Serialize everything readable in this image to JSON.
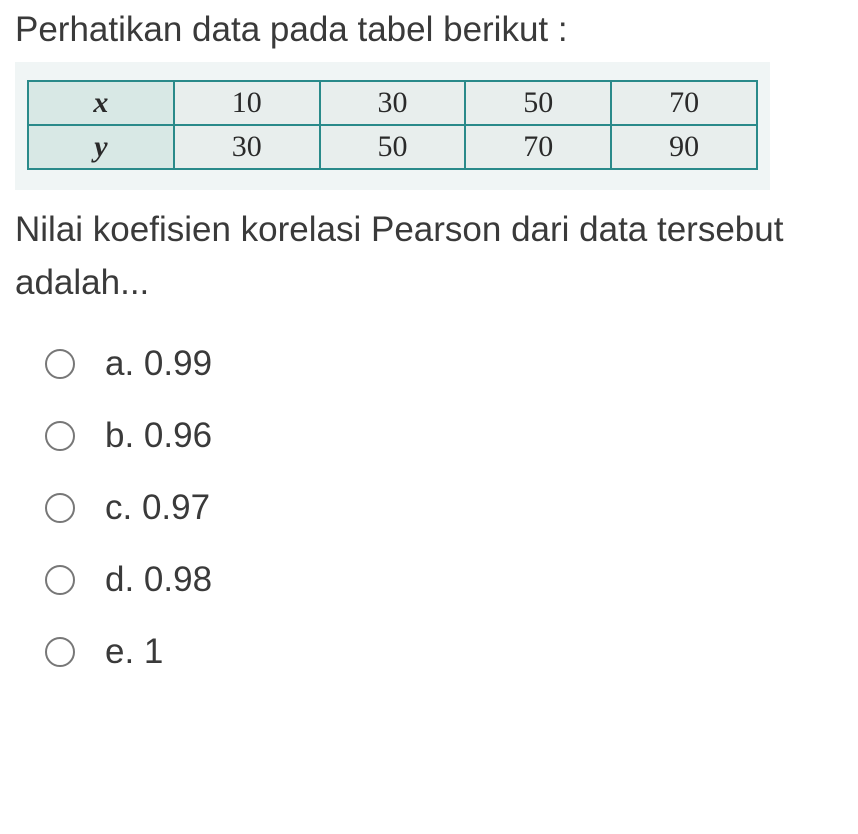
{
  "instruction": "Perhatikan data pada tabel berikut :",
  "table": {
    "row1": {
      "header": "x",
      "c1": "10",
      "c2": "30",
      "c3": "50",
      "c4": "70"
    },
    "row2": {
      "header": "y",
      "c1": "30",
      "c2": "50",
      "c3": "70",
      "c4": "90"
    }
  },
  "question": "Nilai koefisien korelasi Pearson dari data tersebut adalah...",
  "options": {
    "a": "a. 0.99",
    "b": "b. 0.96",
    "c": "c. 0.97",
    "d": "d. 0.98",
    "e": "e. 1"
  }
}
